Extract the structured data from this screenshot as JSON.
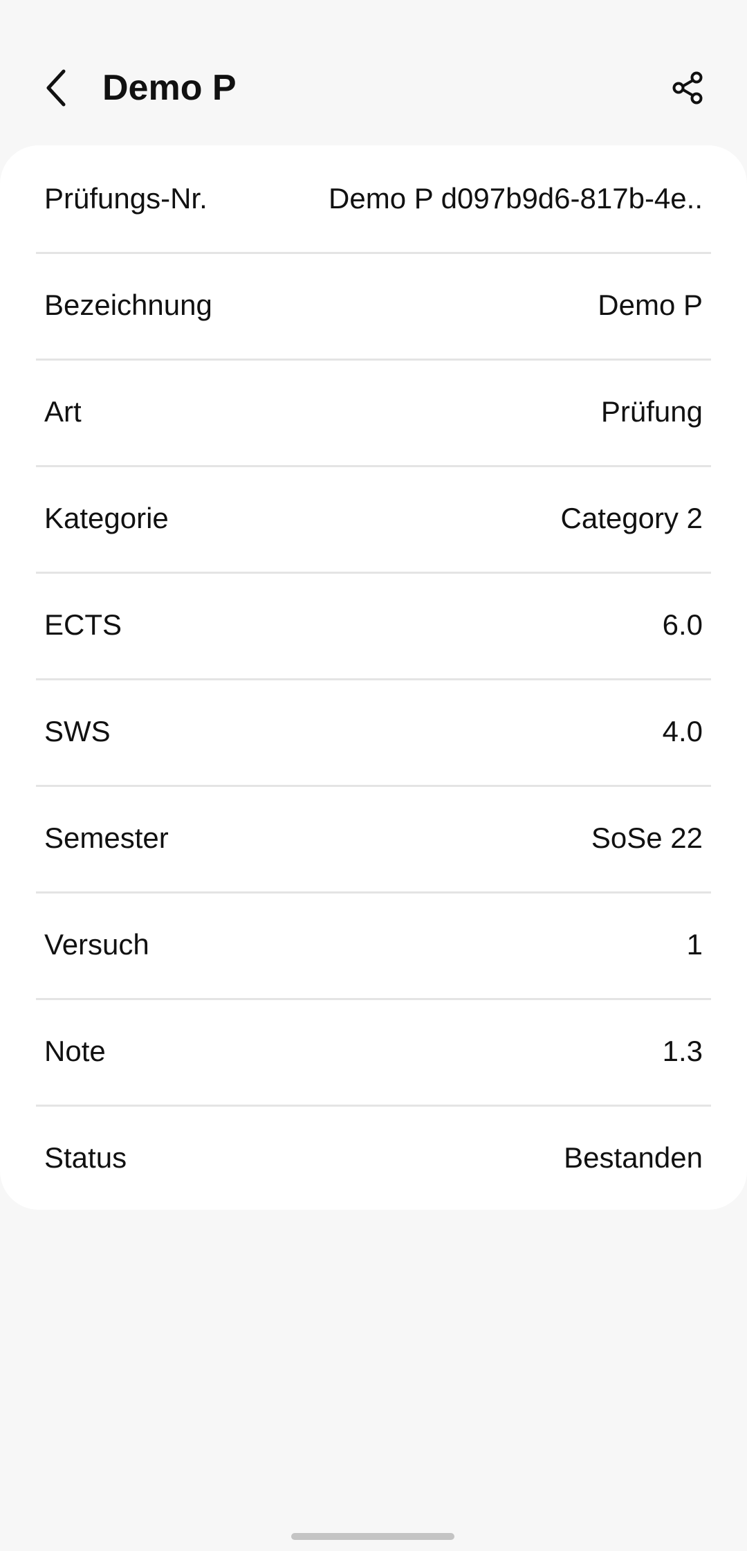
{
  "header": {
    "title": "Demo P"
  },
  "details": [
    {
      "label": "Prüfungs-Nr.",
      "value": "Demo P d097b9d6-817b-4e.."
    },
    {
      "label": "Bezeichnung",
      "value": "Demo P"
    },
    {
      "label": "Art",
      "value": "Prüfung"
    },
    {
      "label": "Kategorie",
      "value": "Category 2"
    },
    {
      "label": "ECTS",
      "value": "6.0"
    },
    {
      "label": "SWS",
      "value": "4.0"
    },
    {
      "label": "Semester",
      "value": "SoSe 22"
    },
    {
      "label": "Versuch",
      "value": "1"
    },
    {
      "label": "Note",
      "value": "1.3"
    },
    {
      "label": "Status",
      "value": "Bestanden"
    }
  ],
  "icons": {
    "back": "chevron-left-icon",
    "share": "share-icon"
  },
  "colors": {
    "background": "#f7f7f7",
    "card": "#ffffff",
    "divider": "#e4e4e4",
    "text": "#111111"
  }
}
